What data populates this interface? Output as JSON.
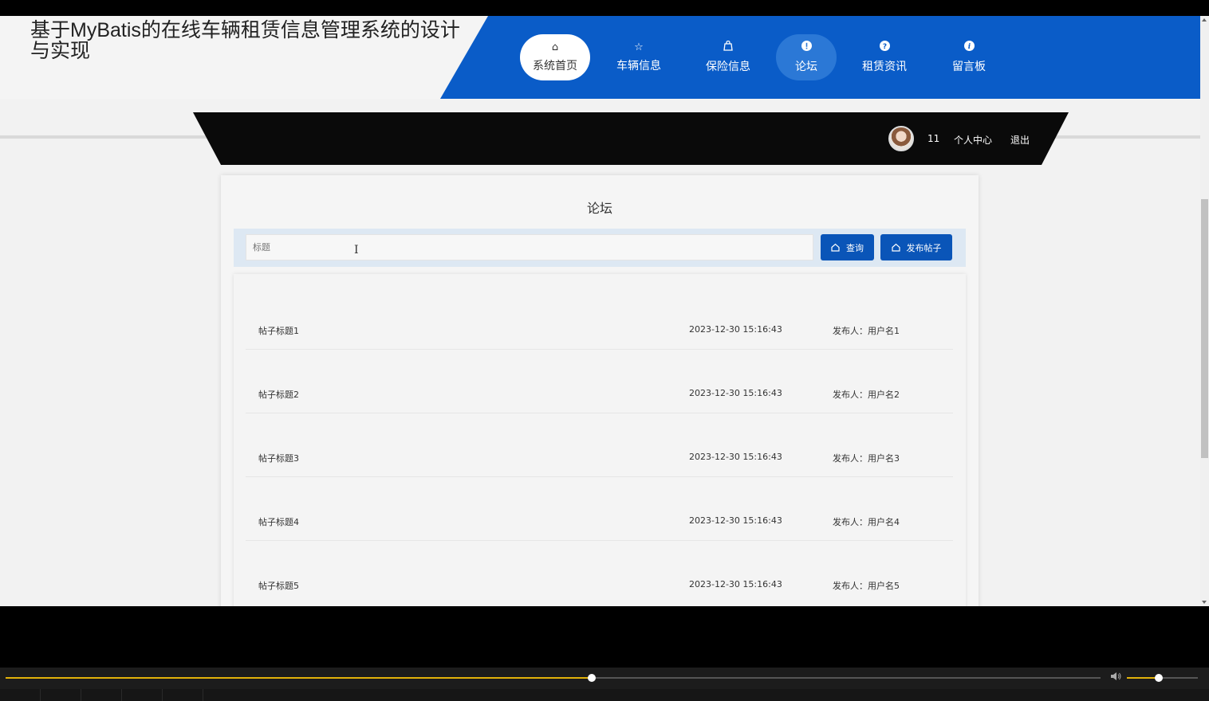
{
  "site": {
    "title": "基于MyBatis的在线车辆租赁信息管理系统的设计与实现"
  },
  "nav": [
    {
      "label": "系统首页",
      "icon": "home-icon",
      "glyph": "⌂"
    },
    {
      "label": "车辆信息",
      "icon": "star-icon",
      "glyph": "☆"
    },
    {
      "label": "保险信息",
      "icon": "bag-icon",
      "glyph": "🛍"
    },
    {
      "label": "论坛",
      "icon": "exclamation-circle-icon",
      "glyph": "!"
    },
    {
      "label": "租赁资讯",
      "icon": "question-circle-icon",
      "glyph": "?"
    },
    {
      "label": "留言板",
      "icon": "info-circle-icon",
      "glyph": "i"
    }
  ],
  "user": {
    "name": "11",
    "center_label": "个人中心",
    "logout_label": "退出"
  },
  "forum": {
    "title": "论坛",
    "search_placeholder": "标题",
    "query_label": "查询",
    "publish_label": "发布帖子",
    "posts": [
      {
        "title": "帖子标题1",
        "date": "2023-12-30 15:16:43",
        "author": "发布人：用户名1"
      },
      {
        "title": "帖子标题2",
        "date": "2023-12-30 15:16:43",
        "author": "发布人：用户名2"
      },
      {
        "title": "帖子标题3",
        "date": "2023-12-30 15:16:43",
        "author": "发布人：用户名3"
      },
      {
        "title": "帖子标题4",
        "date": "2023-12-30 15:16:43",
        "author": "发布人：用户名4"
      },
      {
        "title": "帖子标题5",
        "date": "2023-12-30 15:16:43",
        "author": "发布人：用户名5"
      }
    ]
  },
  "player": {
    "progress_fraction": 0.535,
    "volume_fraction": 0.45
  },
  "colors": {
    "brand_blue": "#0a5cc8",
    "button_blue": "#0a55b8",
    "progress": "#e2b20a"
  }
}
